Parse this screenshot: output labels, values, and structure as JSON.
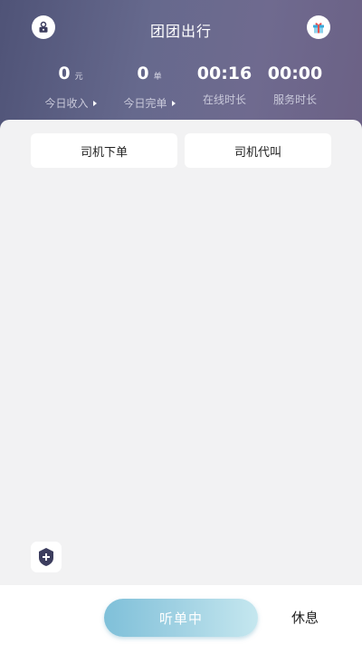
{
  "header": {
    "title": "团团出行",
    "profile_icon": "user-lock-icon",
    "gift_icon": "gift-icon"
  },
  "stats": [
    {
      "value": "0",
      "unit": "元",
      "label": "今日收入",
      "has_arrow": true
    },
    {
      "value": "0",
      "unit": "单",
      "label": "今日完单",
      "has_arrow": true
    },
    {
      "value": "00:16",
      "unit": "",
      "label": "在线时长",
      "has_arrow": false
    },
    {
      "value": "00:00",
      "unit": "",
      "label": "服务时长",
      "has_arrow": false
    }
  ],
  "tabs": [
    {
      "label": "司机下单"
    },
    {
      "label": "司机代叫"
    }
  ],
  "safety_icon": "shield-plus-icon",
  "bottom": {
    "listen_label": "听单中",
    "rest_label": "休息"
  },
  "colors": {
    "header_gradient_start": "#4f5377",
    "header_gradient_end": "#6b6185",
    "listen_gradient_start": "#7fc0d9",
    "listen_gradient_end": "#c5e7ef",
    "shield": "#3c3d5e"
  }
}
